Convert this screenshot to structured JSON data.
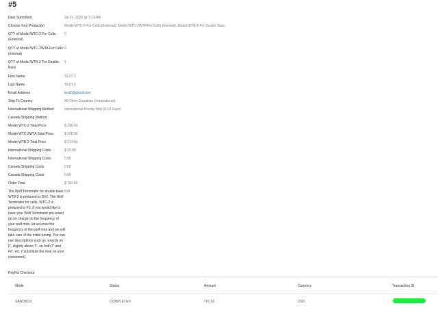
{
  "entry": {
    "title": "#5"
  },
  "fields": [
    {
      "label": "Date Submitted",
      "value": "Jul 21, 2022 @ 1:13 AM"
    },
    {
      "label": "Choose Your Product(s)",
      "value": "Model WTC-2 For Cello (External), Model WTC-2WTA For Cello (Internal), Model WTB-2 For Double Bass"
    },
    {
      "label": "QTY of Model WTC-2 For Cello (External)",
      "value": "2"
    },
    {
      "label": "QTY of Model WTC-2WTA For Cello (Internal)",
      "value": "4"
    },
    {
      "label": "QTY of Model WTB-2 For Double Bass",
      "value": "1"
    },
    {
      "label": "First Name",
      "value": "TEST 2"
    },
    {
      "label": "Last Name",
      "value": "TEST 2"
    },
    {
      "label": "Email Address",
      "value": "test2@gmail.com"
    },
    {
      "label": "Ship To Country",
      "value": "All Other Countries (International)"
    },
    {
      "label": "International Shipping Method",
      "value": "International Priority Mail (6-10 Days)"
    },
    {
      "label": "Canada Shipping Method",
      "value": ""
    },
    {
      "label": "Model WTC-2 Total Price",
      "value": "$ 199.00"
    },
    {
      "label": "Model WTC-2WTA Total Price",
      "value": "$ 438.00"
    },
    {
      "label": "Model WTB-2 Total Price",
      "value": "$ 124.50"
    },
    {
      "label": "International Shipping Costs",
      "value": "$ 20.00"
    },
    {
      "label": "International Shipping Costs",
      "value": "0.00"
    },
    {
      "label": "Canada Shipping Costs",
      "value": "0.00"
    },
    {
      "label": "Canada Shipping Costs",
      "value": "0.00"
    },
    {
      "label": "Order Total",
      "value": "$ 781.50"
    },
    {
      "label": "The Wolf Terminator for double bass, WTB-2 is pretuned to G#2. The Wolf Terminator for cello, WTC-2 is pretuned to F3. If you would like to have your Wolf Terminator pre-tuned (at no charge) to the frequency of your wolf note, let us know the frequency of the wolf note and we will take care of the initial tuning. You can use descriptions such as: exactly on F', slightly above F', on both F' and F#', etc. (*substitute the note on your instrument)",
      "value": "N/A"
    },
    {
      "label": "PayPal Checkout",
      "value": ""
    }
  ],
  "paypal": {
    "headers": {
      "mode": "Mode",
      "status": "Status",
      "amount": "Amount",
      "currency": "Currency",
      "txn": "Transaction ID"
    },
    "row": {
      "mode": "SANDBOX",
      "status": "COMPLETED",
      "amount": "781.50",
      "currency": "USD",
      "txn": ""
    }
  },
  "colors": {
    "link": "#2271b1",
    "redaction": "#19f03a"
  }
}
